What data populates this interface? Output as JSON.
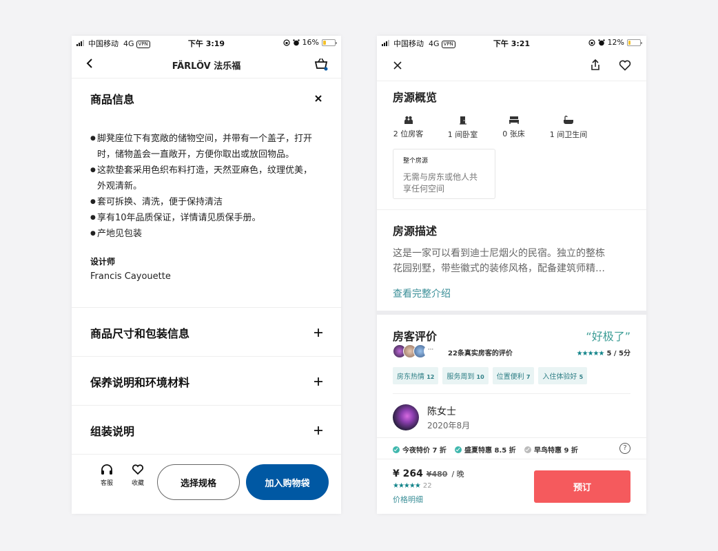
{
  "left": {
    "status": {
      "carrier": "中国移动",
      "network": "4G",
      "vpn": "VPN",
      "time": "下午 3:19",
      "battery": "16%"
    },
    "nav": {
      "title": "FÄRLÖV 法乐福"
    },
    "product_info": {
      "title": "商品信息",
      "bullets": [
        "脚凳座位下有宽敞的储物空间，并带有一个盖子，打开",
        "时，储物盖会一直敞开，方便你取出或放回物品。",
        "这款垫套采用色织布料打造，天然亚麻色，纹理优美，",
        "外观清新。",
        "套可拆换、清洗，便于保持清洁",
        "享有10年品质保证，详情请见质保手册。",
        "产地见包装"
      ],
      "designer_label": "设计师",
      "designer_name": "Francis Cayouette"
    },
    "sections": [
      "商品尺寸和包装信息",
      "保养说明和环境材料",
      "组装说明"
    ],
    "bottom": {
      "service_label": "客服",
      "favorite_label": "收藏",
      "select_spec": "选择规格",
      "add_to_cart": "加入购物袋"
    },
    "accent_color": "#0058a3"
  },
  "right": {
    "status": {
      "carrier": "中国移动",
      "network": "4G",
      "vpn": "VPN",
      "time": "下午 3:21",
      "battery": "12%"
    },
    "overview": {
      "title": "房源概览",
      "facts": [
        "2 位房客",
        "1 间卧室",
        "0 张床",
        "1 间卫生间"
      ],
      "whole_label": "整个房源",
      "whole_desc_1": "无需与房东或他人共",
      "whole_desc_2": "享任何空间"
    },
    "description": {
      "title": "房源描述",
      "line1": "这是一家可以看到迪士尼烟火的民宿。独立的整栋",
      "line2": "花园别墅，带些徽式的装修风格，配备建筑师精…",
      "link": "查看完整介绍"
    },
    "reviews": {
      "title": "房客评价",
      "badge": "“好极了”",
      "more": "···",
      "count_text": "22条真实房客的评价",
      "stars": "★★★★★",
      "score": "5 / 5分",
      "tags": [
        {
          "label": "房东热情",
          "count": "12"
        },
        {
          "label": "服务周到",
          "count": "10"
        },
        {
          "label": "位置便利",
          "count": "7"
        },
        {
          "label": "入住体验好",
          "count": "5"
        }
      ],
      "reviewer_name": "陈女士",
      "reviewer_date": "2020年8月"
    },
    "promos": [
      "今夜特价 7 折",
      "盛夏特惠 8.5 折",
      "早鸟特惠 9 折"
    ],
    "help": "?",
    "booking": {
      "price": "¥ 264",
      "old_price": "¥480",
      "per": "/ 晚",
      "stars": "★★★★★",
      "review_count": "22",
      "price_detail": "价格明细",
      "book": "预订"
    },
    "colors": {
      "teal": "#12848a",
      "book": "#f55a5d"
    }
  }
}
